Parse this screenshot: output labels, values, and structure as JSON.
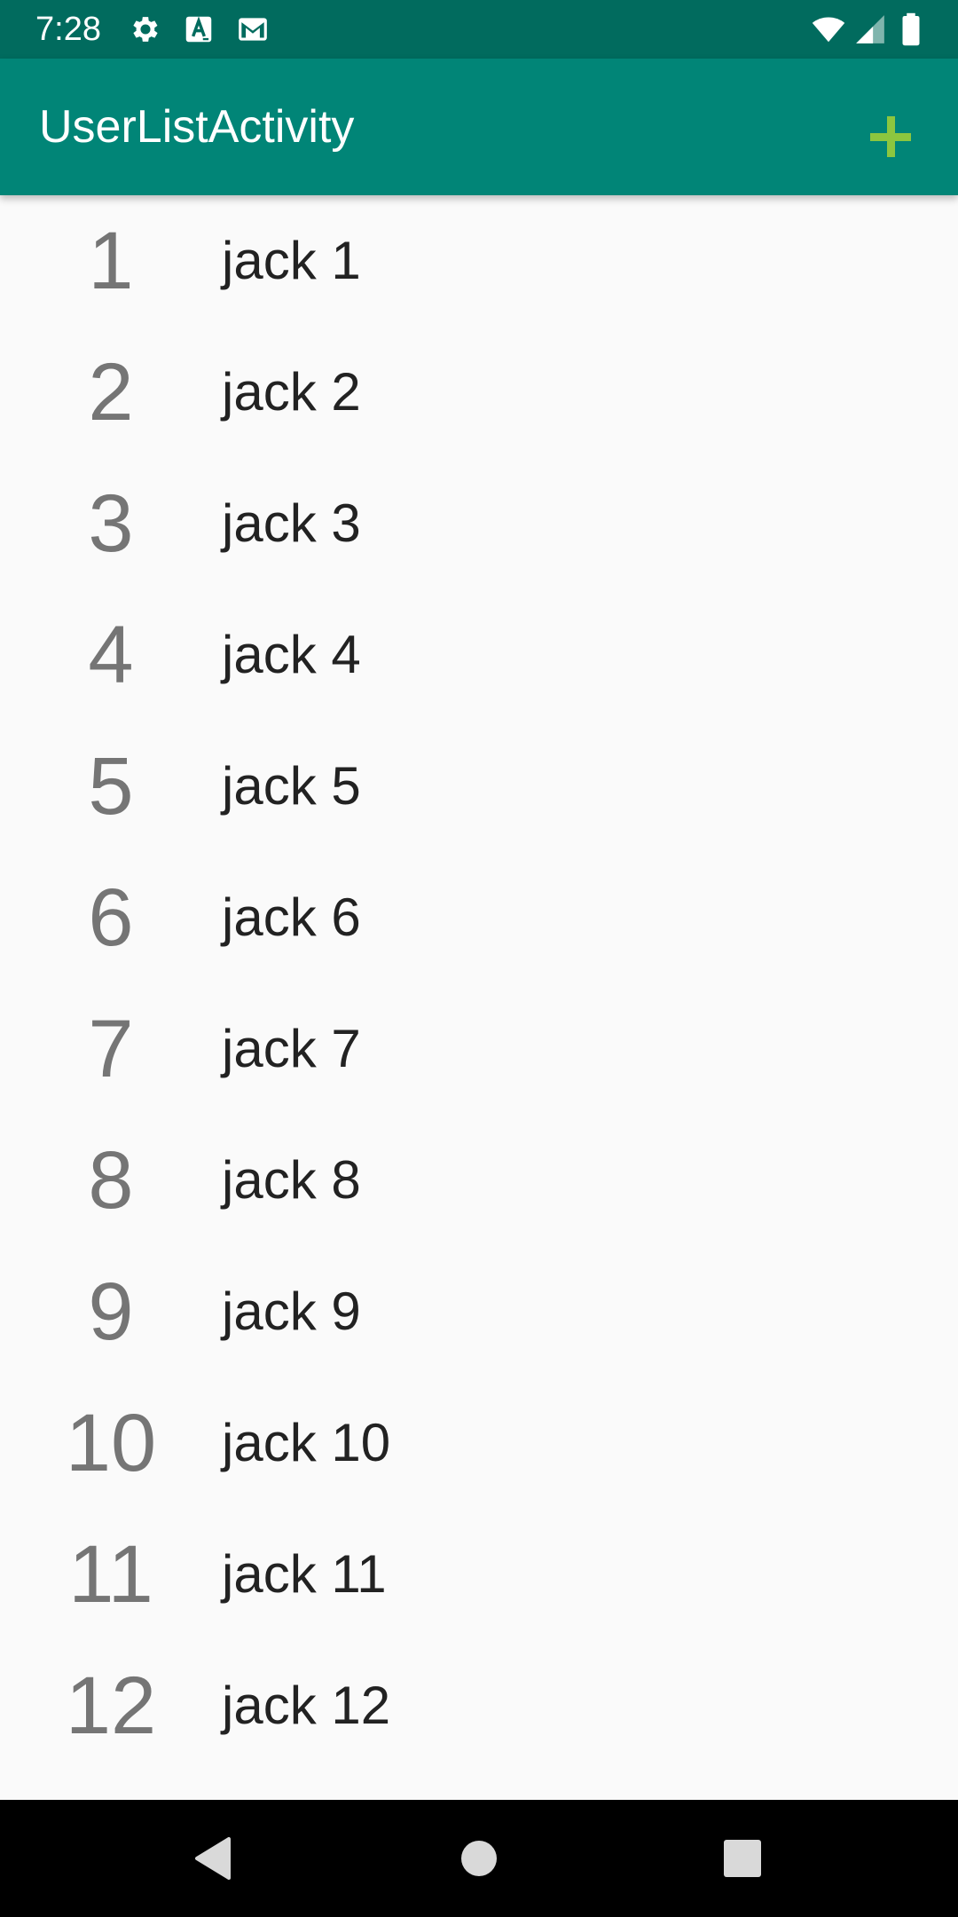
{
  "status_bar": {
    "time": "7:28",
    "icons": [
      "settings-icon",
      "text-a-icon",
      "gmail-icon",
      "wifi-icon",
      "signal-icon",
      "battery-icon"
    ],
    "background_color": "#016b5e"
  },
  "app_bar": {
    "title": "UserListActivity",
    "background_color": "#018577",
    "action_icon": "add-icon",
    "action_color": "#8cc63f"
  },
  "list": {
    "items": [
      {
        "number": "1",
        "name": "jack 1"
      },
      {
        "number": "2",
        "name": "jack 2"
      },
      {
        "number": "3",
        "name": "jack 3"
      },
      {
        "number": "4",
        "name": "jack 4"
      },
      {
        "number": "5",
        "name": "jack 5"
      },
      {
        "number": "6",
        "name": "jack 6"
      },
      {
        "number": "7",
        "name": "jack 7"
      },
      {
        "number": "8",
        "name": "jack 8"
      },
      {
        "number": "9",
        "name": "jack 9"
      },
      {
        "number": "10",
        "name": "jack 10"
      },
      {
        "number": "11",
        "name": "jack 11"
      },
      {
        "number": "12",
        "name": "jack 12"
      }
    ]
  },
  "nav_bar": {
    "icons": [
      "back-icon",
      "home-icon",
      "recents-icon"
    ]
  }
}
